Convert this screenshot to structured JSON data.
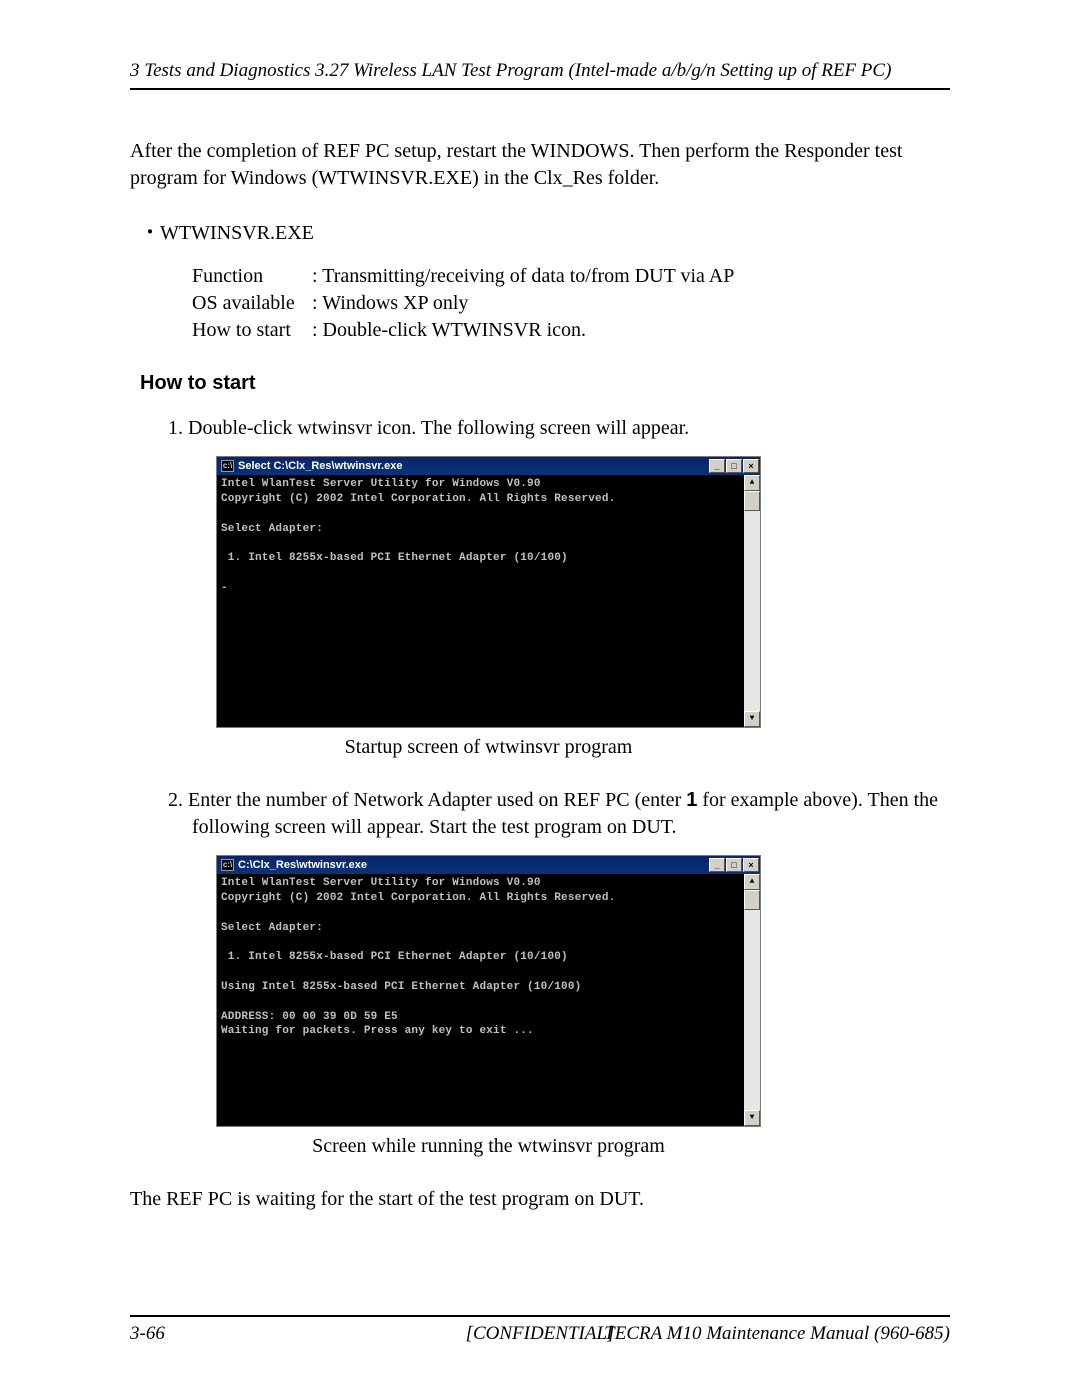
{
  "header": "3 Tests and Diagnostics   3.27 Wireless LAN Test Program (Intel-made a/b/g/n Setting up of REF PC)",
  "intro_para": "After the completion of REF PC setup, restart the WINDOWS. Then perform the Responder test program for Windows (WTWINSVR.EXE) in the Clx_Res folder.",
  "bullet": "・WTWINSVR.EXE",
  "defs": {
    "function_label": "Function",
    "function_value": ": Transmitting/receiving of data to/from DUT via AP",
    "os_label": "OS available",
    "os_value": ": Windows XP only",
    "howstart_label": "How to start",
    "howstart_value": ": Double-click WTWINSVR icon."
  },
  "section_head": "How to start",
  "step1": "1. Double-click wtwinsvr icon. The following screen will appear.",
  "term1": {
    "title": "Select C:\\Clx_Res\\wtwinsvr.exe",
    "content": "Intel WlanTest Server Utility for Windows V0.90\nCopyright (C) 2002 Intel Corporation. All Rights Reserved.\n\nSelect Adapter:\n\n 1. Intel 8255x-based PCI Ethernet Adapter (10/100)\n\n-"
  },
  "caption1": "Startup screen of wtwinsvr program",
  "step2_pre": "2. Enter the number of Network Adapter used on REF PC (enter ",
  "step2_bold": "1",
  "step2_post": " for example above). Then the following screen will appear. Start the test program on DUT.",
  "term2": {
    "title": "C:\\Clx_Res\\wtwinsvr.exe",
    "content": "Intel WlanTest Server Utility for Windows V0.90\nCopyright (C) 2002 Intel Corporation. All Rights Reserved.\n\nSelect Adapter:\n\n 1. Intel 8255x-based PCI Ethernet Adapter (10/100)\n\nUsing Intel 8255x-based PCI Ethernet Adapter (10/100)\n\nADDRESS: 00 00 39 0D 59 E5\nWaiting for packets. Press any key to exit ..."
  },
  "caption2": "Screen while running the wtwinsvr program",
  "closing": "The REF PC is waiting for the start of the test program on DUT.",
  "footer": {
    "left": "3-66",
    "mid": "[CONFIDENTIAL]",
    "right": "TECRA M10 Maintenance Manual (960-685)"
  }
}
